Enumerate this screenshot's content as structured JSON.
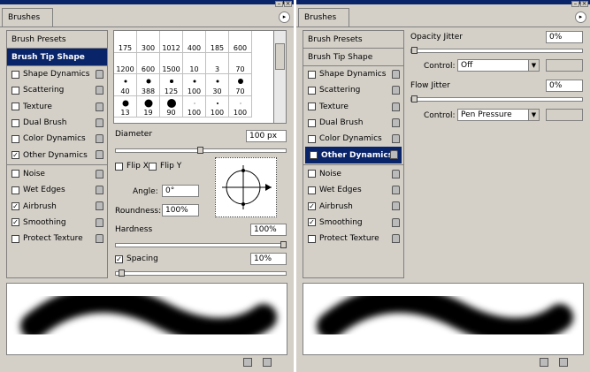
{
  "left": {
    "tab": "Brushes",
    "presets_label": "Brush Presets",
    "tip_shape_label": "Brush Tip Shape",
    "options": [
      {
        "label": "Shape Dynamics",
        "checked": false,
        "lock": true
      },
      {
        "label": "Scattering",
        "checked": false,
        "lock": true
      },
      {
        "label": "Texture",
        "checked": false,
        "lock": true
      },
      {
        "label": "Dual Brush",
        "checked": false,
        "lock": true
      },
      {
        "label": "Color Dynamics",
        "checked": false,
        "lock": true
      },
      {
        "label": "Other Dynamics",
        "checked": true,
        "lock": true
      },
      {
        "label": "Noise",
        "checked": false,
        "lock": true
      },
      {
        "label": "Wet Edges",
        "checked": false,
        "lock": true
      },
      {
        "label": "Airbrush",
        "checked": true,
        "lock": true
      },
      {
        "label": "Smoothing",
        "checked": true,
        "lock": true
      },
      {
        "label": "Protect Texture",
        "checked": false,
        "lock": true
      }
    ],
    "brush_sizes": [
      "175",
      "300",
      "1012",
      "400",
      "185",
      "600",
      "1200",
      "600",
      "1500",
      "10",
      "3",
      "70",
      "40",
      "388",
      "125",
      "100",
      "30",
      "70",
      "13",
      "19",
      "90",
      "100",
      "100",
      "100"
    ],
    "diameter_label": "Diameter",
    "diameter_value": "100 px",
    "flip_x_label": "Flip X",
    "flip_y_label": "Flip Y",
    "angle_label": "Angle:",
    "angle_value": "0°",
    "roundness_label": "Roundness:",
    "roundness_value": "100%",
    "hardness_label": "Hardness",
    "hardness_value": "100%",
    "spacing_label": "Spacing",
    "spacing_value": "10%",
    "spacing_checked": true
  },
  "right": {
    "tab": "Brushes",
    "presets_label": "Brush Presets",
    "tip_shape_label": "Brush Tip Shape",
    "options": [
      {
        "label": "Shape Dynamics",
        "checked": false,
        "lock": true
      },
      {
        "label": "Scattering",
        "checked": false,
        "lock": true
      },
      {
        "label": "Texture",
        "checked": false,
        "lock": true
      },
      {
        "label": "Dual Brush",
        "checked": false,
        "lock": true
      },
      {
        "label": "Color Dynamics",
        "checked": false,
        "lock": true
      },
      {
        "label": "Other Dynamics",
        "checked": true,
        "lock": true,
        "selected": true
      },
      {
        "label": "Noise",
        "checked": false,
        "lock": true
      },
      {
        "label": "Wet Edges",
        "checked": false,
        "lock": true
      },
      {
        "label": "Airbrush",
        "checked": true,
        "lock": true
      },
      {
        "label": "Smoothing",
        "checked": true,
        "lock": true
      },
      {
        "label": "Protect Texture",
        "checked": false,
        "lock": true
      }
    ],
    "opacity_jitter_label": "Opacity Jitter",
    "opacity_jitter_value": "0%",
    "control_label": "Control:",
    "opacity_control_value": "Off",
    "flow_jitter_label": "Flow Jitter",
    "flow_jitter_value": "0%",
    "flow_control_value": "Pen Pressure"
  },
  "colors": {
    "panel": "#d4d0c8",
    "selected": "#0a246a"
  }
}
